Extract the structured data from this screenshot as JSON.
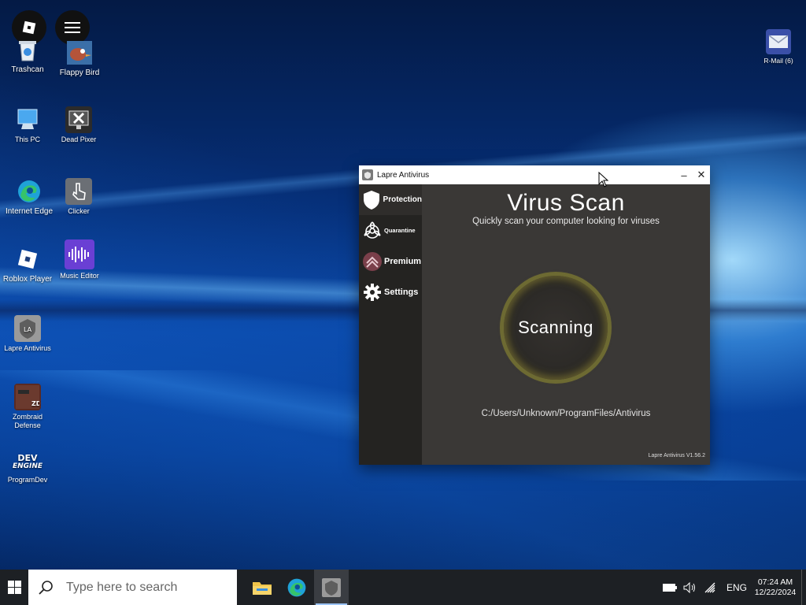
{
  "desktop": {
    "icons": [
      {
        "label": "Trashcan",
        "icon": "trashcan-icon"
      },
      {
        "label": "Flappy Bird",
        "icon": "flappy-bird-icon"
      },
      {
        "label": "This PC",
        "icon": "computer-icon"
      },
      {
        "label": "Dead Pixer",
        "icon": "dead-pixer-icon"
      },
      {
        "label": "Internet Edge",
        "icon": "edge-icon"
      },
      {
        "label": "Clicker",
        "icon": "clicker-icon"
      },
      {
        "label": "Roblox Player",
        "icon": "roblox-icon"
      },
      {
        "label": "Music Editor",
        "icon": "music-editor-icon"
      },
      {
        "label": "Lapre Antivirus",
        "icon": "lapre-antivirus-icon"
      },
      {
        "label": "Zombraid Defense",
        "icon": "zombraid-icon"
      },
      {
        "label": "ProgramDev",
        "icon": "devengine-icon"
      },
      {
        "label": "R-Mail (6)",
        "icon": "mail-icon"
      }
    ],
    "zd_badge": "ZD",
    "dev_text": "DEV",
    "engine_text": "ENGINE",
    "la_text": "LA"
  },
  "window": {
    "title": "Lapre Antivirus",
    "minimize_glyph": "–",
    "close_glyph": "✕",
    "sidebar": [
      {
        "label": "Protection",
        "icon": "shield-icon"
      },
      {
        "label": "Quarantine",
        "icon": "biohazard-icon"
      },
      {
        "label": "Premium",
        "icon": "premium-icon"
      },
      {
        "label": "Settings",
        "icon": "gear-icon"
      }
    ],
    "heading": "Virus Scan",
    "subheading": "Quickly scan your computer looking for viruses",
    "status": "Scanning",
    "current_path": "C:/Users/Unknown/ProgramFiles/Antivirus",
    "version": "Lapre Antivirus V1.56.2"
  },
  "taskbar": {
    "search_placeholder": "Type here to search",
    "apps": [
      "file-explorer-icon",
      "edge-icon",
      "lapre-antivirus-icon"
    ],
    "language": "ENG",
    "time": "07:24 AM",
    "date": "12/22/2024"
  },
  "colors": {
    "ring": "#6d6a32",
    "taskbar": "#1d2024",
    "sidebar": "#242321",
    "window_bg": "#3a3836"
  }
}
